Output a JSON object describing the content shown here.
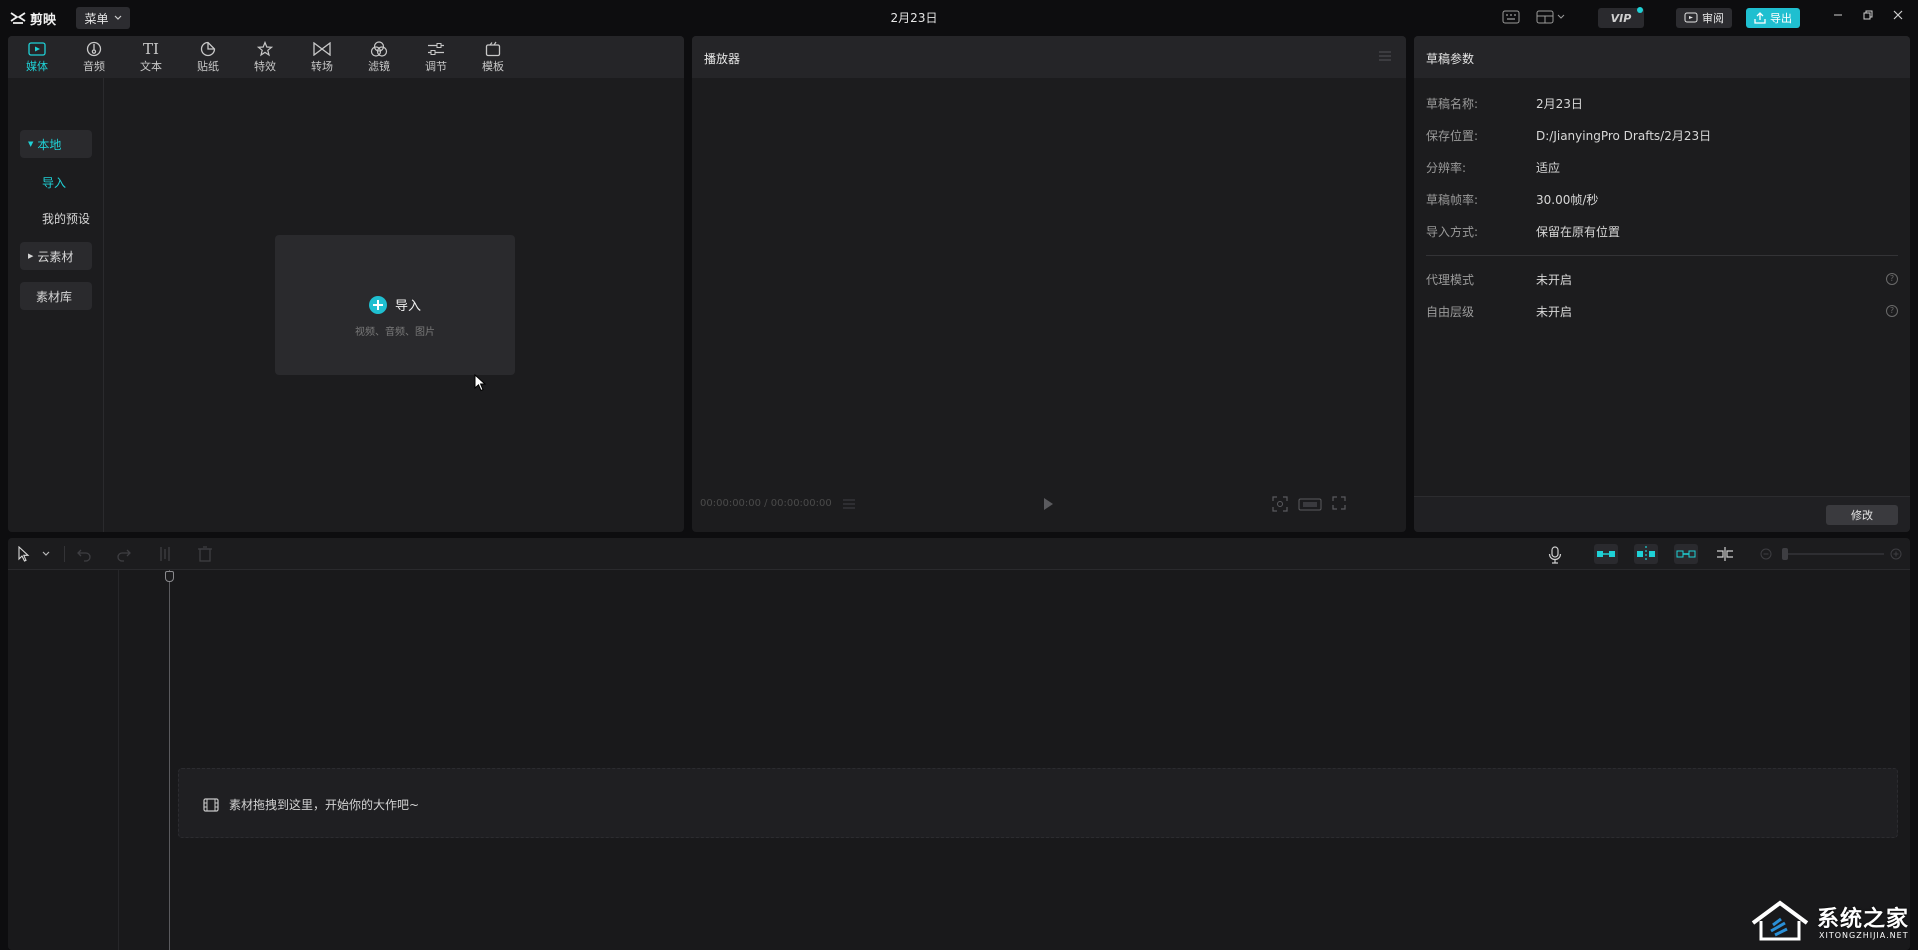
{
  "titlebar": {
    "app_name": "剪映",
    "menu_label": "菜单",
    "title": "2月23日",
    "vip_label": "VIP",
    "review_label": "审阅",
    "export_label": "导出"
  },
  "media": {
    "tools": [
      {
        "label": "媒体",
        "icon": "media-icon",
        "active": true
      },
      {
        "label": "音频",
        "icon": "audio-icon"
      },
      {
        "label": "文本",
        "icon": "text-icon"
      },
      {
        "label": "贴纸",
        "icon": "sticker-icon"
      },
      {
        "label": "特效",
        "icon": "effects-icon"
      },
      {
        "label": "转场",
        "icon": "transition-icon"
      },
      {
        "label": "滤镜",
        "icon": "filter-icon"
      },
      {
        "label": "调节",
        "icon": "adjust-icon"
      },
      {
        "label": "模板",
        "icon": "template-icon"
      }
    ],
    "sidebar": {
      "local": "本地",
      "import": "导入",
      "my_presets": "我的预设",
      "cloud": "云素材",
      "library": "素材库"
    },
    "import_card": {
      "label": "导入",
      "hint": "视频、音频、图片"
    }
  },
  "player": {
    "title": "播放器",
    "timecode": "00:00:00:00 / 00:00:00:00"
  },
  "properties": {
    "title": "草稿参数",
    "rows": [
      {
        "key": "草稿名称:",
        "value": "2月23日"
      },
      {
        "key": "保存位置:",
        "value": "D:/JianyingPro Drafts/2月23日"
      },
      {
        "key": "分辨率:",
        "value": "适应"
      },
      {
        "key": "草稿帧率:",
        "value": "30.00帧/秒"
      },
      {
        "key": "导入方式:",
        "value": "保留在原有位置"
      }
    ],
    "extra_rows": [
      {
        "key": "代理模式",
        "value": "未开启"
      },
      {
        "key": "自由层级",
        "value": "未开启"
      }
    ],
    "modify_label": "修改"
  },
  "timeline": {
    "drop_hint": "素材拖拽到这里，开始你的大作吧~"
  },
  "watermark": {
    "text": "系统之家",
    "sub": "XITONGZHIJIA.NET"
  },
  "colors": {
    "accent": "#1fd1d6",
    "export": "#1fbfd0",
    "panel": "#1c1c1e"
  }
}
